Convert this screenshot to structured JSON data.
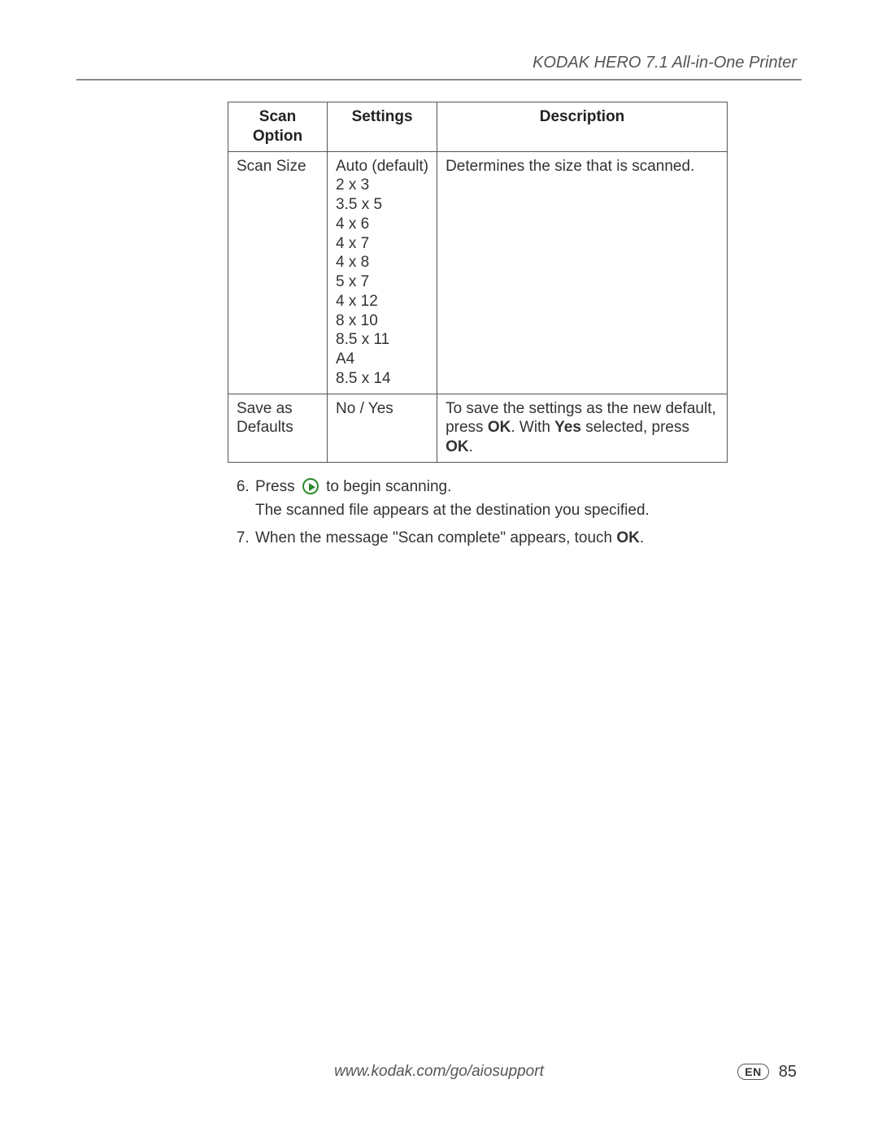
{
  "header": {
    "title": "KODAK HERO 7.1 All-in-One Printer"
  },
  "table": {
    "headers": {
      "option": "Scan Option",
      "settings": "Settings",
      "description": "Description"
    },
    "rows": [
      {
        "option": "Scan Size",
        "settings": [
          "Auto (default)",
          "2 x 3",
          "3.5 x 5",
          "4 x 6",
          "4 x 7",
          "4 x 8",
          "5 x 7",
          "4 x 12",
          "8 x 10",
          "8.5 x 11",
          "A4",
          "8.5 x 14"
        ],
        "description": "Determines the size that is scanned."
      },
      {
        "option": "Save as Defaults",
        "settings_text": "No / Yes",
        "description_parts": {
          "pre": "To save the settings as the new default, press ",
          "ok1": "OK",
          "mid": ". With ",
          "yes": "Yes",
          "mid2": " selected, press ",
          "ok2": "OK",
          "end": "."
        }
      }
    ]
  },
  "steps": {
    "start": 6,
    "items": [
      {
        "num": "6.",
        "line1_pre": "Press ",
        "line1_post": " to begin scanning.",
        "line2": "The scanned file appears at the destination you specified."
      },
      {
        "num": "7.",
        "line_pre": "When the message \"Scan complete\" appears, touch ",
        "ok": "OK",
        "end": "."
      }
    ]
  },
  "footer": {
    "url": "www.kodak.com/go/aiosupport",
    "lang": "EN",
    "page": "85"
  }
}
